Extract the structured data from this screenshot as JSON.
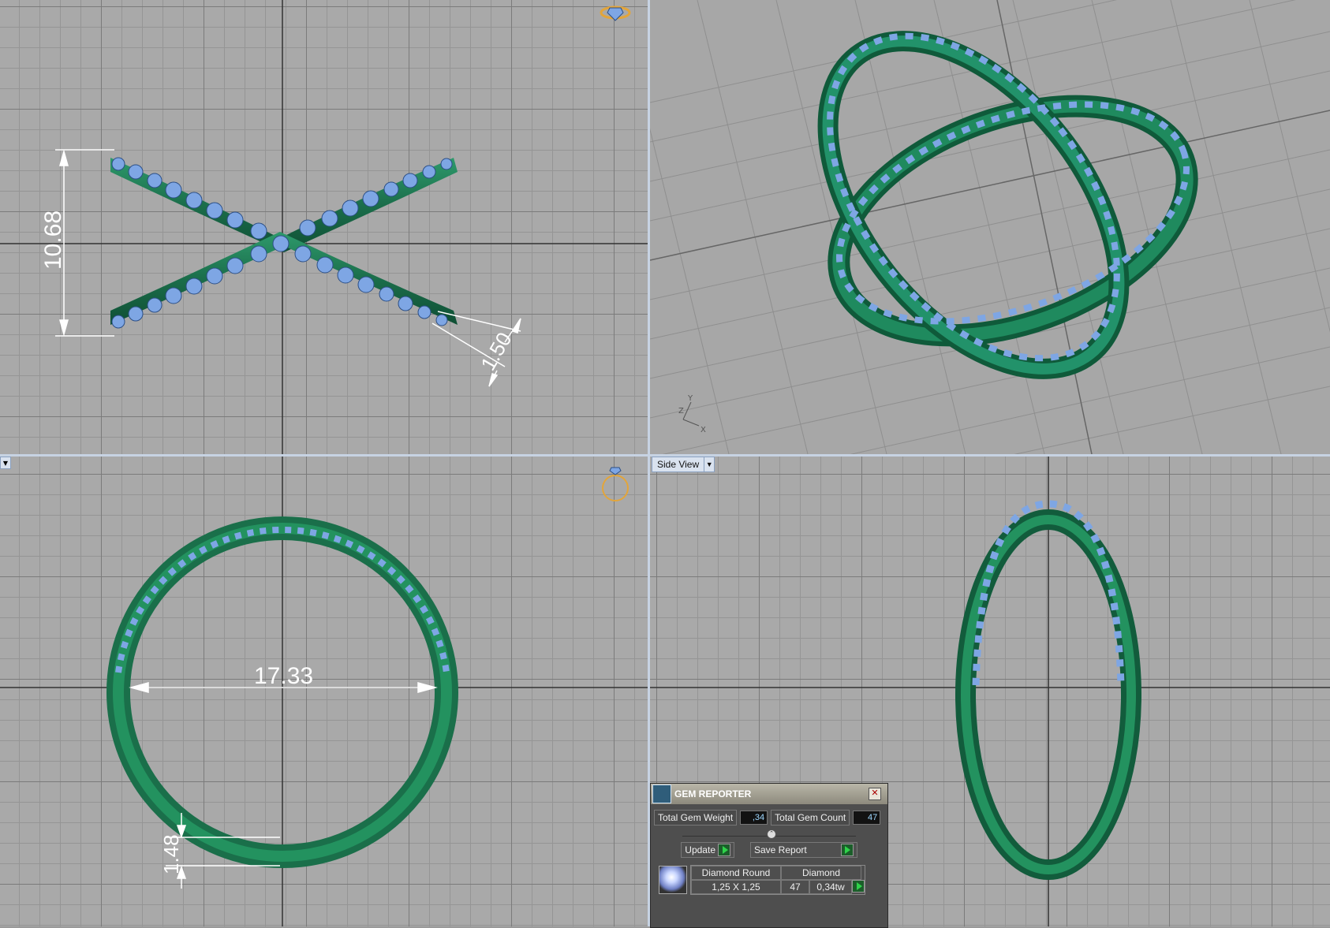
{
  "viewports": {
    "top": {
      "dim_height": "10.68",
      "dim_band": "1.50"
    },
    "perspective": {
      "axis_z": "Z",
      "axis_y": "Y",
      "axis_x": "X"
    },
    "front": {
      "dim_diameter": "17.33",
      "dim_thickness": "1.48"
    },
    "side": {
      "label": "Side View"
    }
  },
  "gem_reporter": {
    "title": "GEM REPORTER",
    "total_gem_weight_label": "Total Gem Weight",
    "total_gem_weight_value": ",34",
    "total_gem_count_label": "Total Gem Count",
    "total_gem_count_value": "47",
    "update_label": "Update",
    "save_report_label": "Save Report",
    "gem": {
      "shape": "Diamond Round",
      "material": "Diamond",
      "size": "1,25 X 1,25",
      "count": "47",
      "weight": "0,34tw"
    }
  },
  "colors": {
    "metal": "#1f7a55",
    "gem": "#7ea6e4",
    "grid_bg": "#a9a9a9",
    "splitter": "#c7d3e3"
  }
}
